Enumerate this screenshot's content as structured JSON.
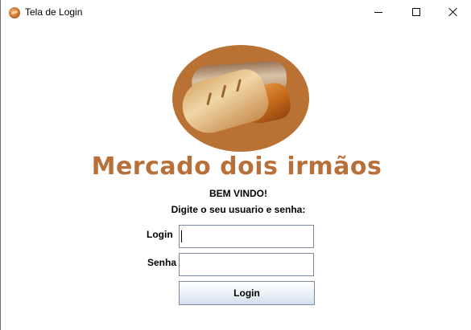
{
  "window": {
    "title": "Tela de Login",
    "icon": "bread-icon",
    "controls": [
      "minimize-icon",
      "maximize-icon",
      "close-icon"
    ]
  },
  "logo": {
    "brand_text": "Mercado dois irmãos",
    "brand_color": "#b8703a",
    "circle_color": "#b97134"
  },
  "form": {
    "welcome": "BEM VINDO!",
    "instruction": "Digite o seu usuario e senha:",
    "login_label": "Login",
    "login_value": "",
    "password_label": "Senha",
    "password_value": "",
    "submit_label": "Login"
  }
}
